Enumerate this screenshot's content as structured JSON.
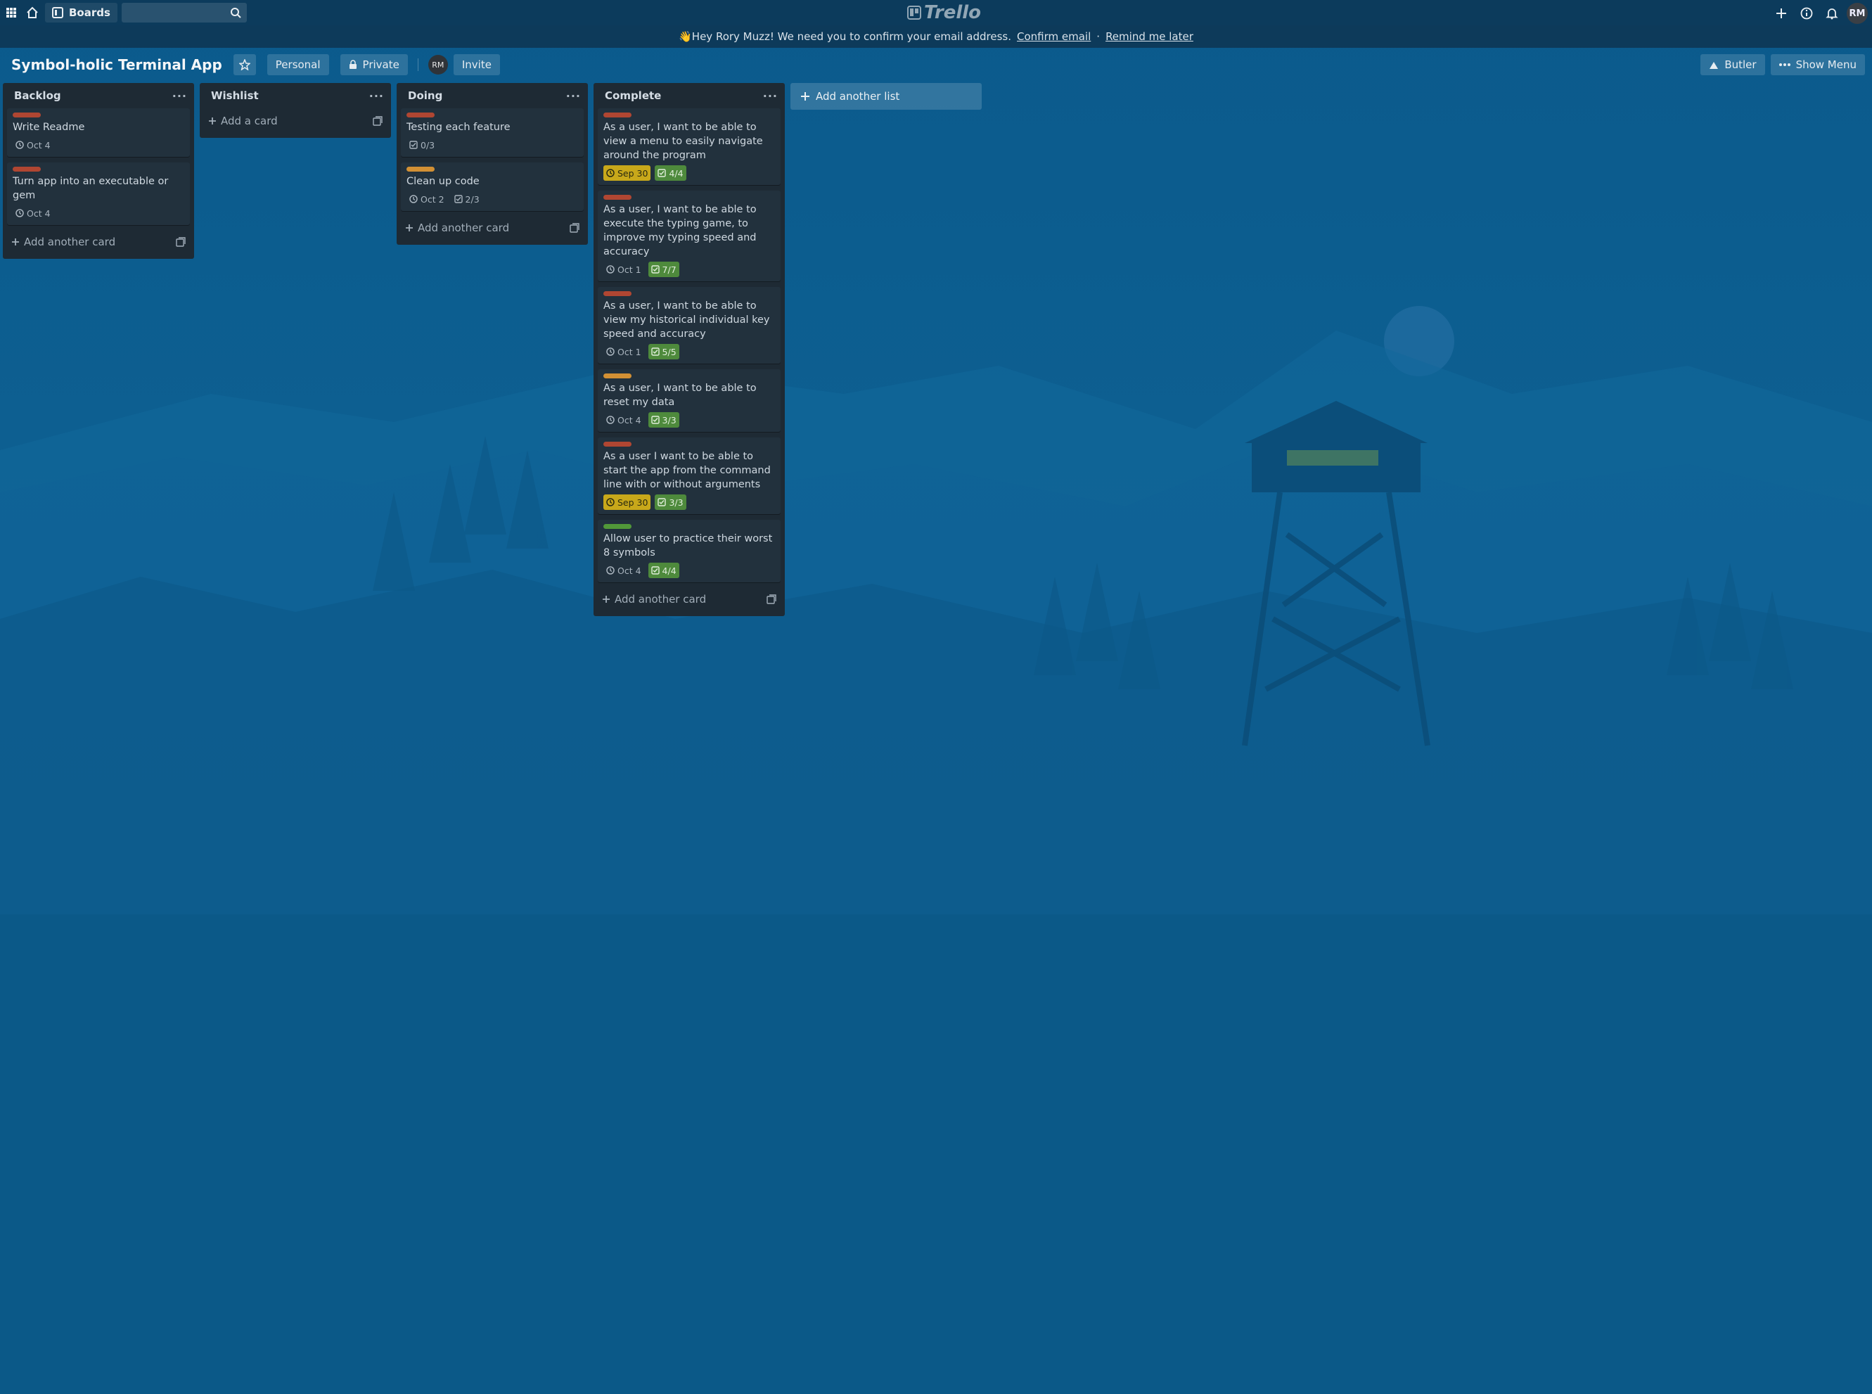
{
  "topbar": {
    "boards_label": "Boards",
    "logo_text": "Trello",
    "avatar_initials": "RM"
  },
  "banner": {
    "message": "👋Hey Rory Muzz! We need you to confirm your email address.",
    "confirm_link": "Confirm email",
    "separator": "·",
    "remind_link": "Remind me later"
  },
  "board": {
    "title": "Symbol-holic Terminal App",
    "team": "Personal",
    "visibility": "Private",
    "member_initials": "RM",
    "invite_label": "Invite",
    "butler_label": "Butler",
    "menu_label": "Show Menu"
  },
  "lists": [
    {
      "name": "Backlog",
      "add_label": "Add another card",
      "cards": [
        {
          "title": "Write Readme",
          "label_color": "#b04632",
          "due": "Oct 4",
          "due_status": "plain",
          "checklist": null
        },
        {
          "title": "Turn app into an executable or gem",
          "label_color": "#b04632",
          "due": "Oct 4",
          "due_status": "plain",
          "checklist": null
        }
      ]
    },
    {
      "name": "Wishlist",
      "add_label": "Add a card",
      "cards": []
    },
    {
      "name": "Doing",
      "add_label": "Add another card",
      "cards": [
        {
          "title": "Testing each feature",
          "label_color": "#b04632",
          "due": null,
          "due_status": "plain",
          "checklist": "0/3",
          "checklist_status": "plain"
        },
        {
          "title": "Clean up code",
          "label_color": "#d29034",
          "due": "Oct 2",
          "due_status": "plain",
          "checklist": "2/3",
          "checklist_status": "plain"
        }
      ]
    },
    {
      "name": "Complete",
      "add_label": "Add another card",
      "cards": [
        {
          "title": "As a user, I want to be able to view a menu to easily navigate around the program",
          "label_color": "#b04632",
          "due": "Sep 30",
          "due_status": "due-soon",
          "checklist": "4/4",
          "checklist_status": "done"
        },
        {
          "title": "As a user, I want to be able to execute the typing game, to improve my typing speed and accuracy",
          "label_color": "#b04632",
          "due": "Oct 1",
          "due_status": "plain",
          "checklist": "7/7",
          "checklist_status": "done"
        },
        {
          "title": "As a user, I want to be able to view my historical individual key speed and accuracy",
          "label_color": "#b04632",
          "due": "Oct 1",
          "due_status": "plain",
          "checklist": "5/5",
          "checklist_status": "done"
        },
        {
          "title": "As a user, I want to be able to reset my data",
          "label_color": "#d29034",
          "due": "Oct 4",
          "due_status": "plain",
          "checklist": "3/3",
          "checklist_status": "done"
        },
        {
          "title": "As a user I want to be able to start the app from the command line with or without arguments",
          "label_color": "#b04632",
          "due": "Sep 30",
          "due_status": "due-soon",
          "checklist": "3/3",
          "checklist_status": "done"
        },
        {
          "title": "Allow user to practice their worst 8 symbols",
          "label_color": "#519839",
          "due": "Oct 4",
          "due_status": "plain",
          "checklist": "4/4",
          "checklist_status": "done"
        }
      ]
    }
  ],
  "add_list_label": "Add another list"
}
